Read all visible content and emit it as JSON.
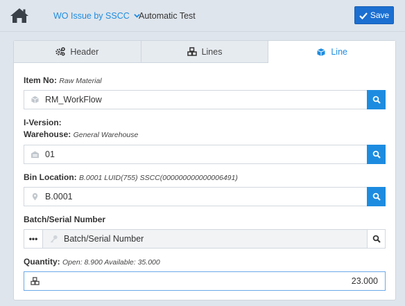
{
  "header": {
    "module_label": "WO Issue by SSCC",
    "subtitle": "Automatic Test",
    "save_label": "Save"
  },
  "tabs": [
    {
      "label": "Header",
      "icon": "cogs-icon"
    },
    {
      "label": "Lines",
      "icon": "cubes-icon"
    },
    {
      "label": "Line",
      "icon": "cube-icon",
      "active": true
    }
  ],
  "form": {
    "item": {
      "label": "Item No:",
      "desc": "Raw Material",
      "value": "RM_WorkFlow"
    },
    "iversion": {
      "label": "I-Version:"
    },
    "warehouse": {
      "label": "Warehouse:",
      "desc": "General Warehouse",
      "value": "01"
    },
    "bin": {
      "label": "Bin Location:",
      "desc": "B.0001 LUID(755) SSCC(000000000000006491)",
      "value": "B.0001"
    },
    "batch": {
      "label": "Batch/Serial Number",
      "placeholder": "Batch/Serial Number",
      "dots": "•••"
    },
    "quantity": {
      "label": "Quantity:",
      "desc": "Open: 8.900 Available: 35.000",
      "value": "23.000"
    }
  },
  "colors": {
    "accent": "#1d8ce0",
    "save": "#1b6fd1"
  }
}
